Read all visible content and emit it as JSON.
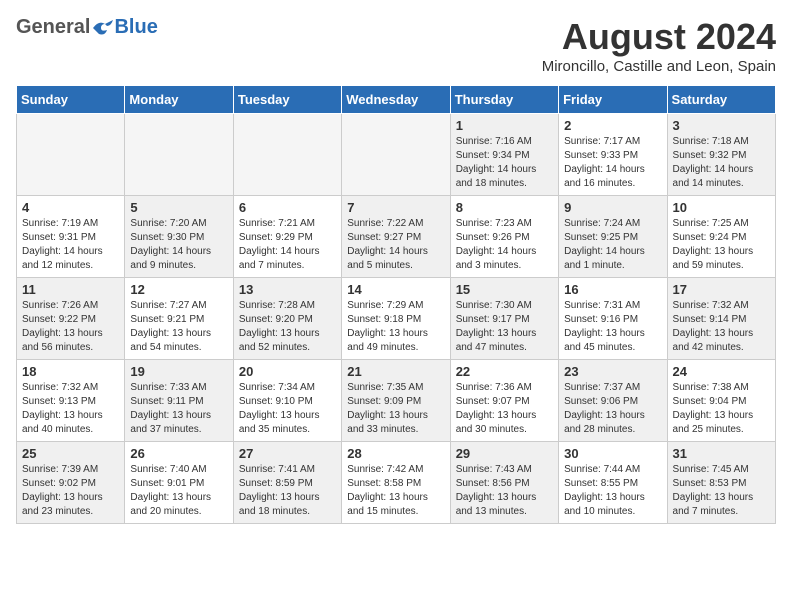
{
  "header": {
    "logo_general": "General",
    "logo_blue": "Blue",
    "title": "August 2024",
    "subtitle": "Mironcillo, Castille and Leon, Spain"
  },
  "days_of_week": [
    "Sunday",
    "Monday",
    "Tuesday",
    "Wednesday",
    "Thursday",
    "Friday",
    "Saturday"
  ],
  "weeks": [
    [
      {
        "day": "",
        "detail": "",
        "empty": true
      },
      {
        "day": "",
        "detail": "",
        "empty": true
      },
      {
        "day": "",
        "detail": "",
        "empty": true
      },
      {
        "day": "",
        "detail": "",
        "empty": true
      },
      {
        "day": "1",
        "detail": "Sunrise: 7:16 AM\nSunset: 9:34 PM\nDaylight: 14 hours\nand 18 minutes."
      },
      {
        "day": "2",
        "detail": "Sunrise: 7:17 AM\nSunset: 9:33 PM\nDaylight: 14 hours\nand 16 minutes."
      },
      {
        "day": "3",
        "detail": "Sunrise: 7:18 AM\nSunset: 9:32 PM\nDaylight: 14 hours\nand 14 minutes."
      }
    ],
    [
      {
        "day": "4",
        "detail": "Sunrise: 7:19 AM\nSunset: 9:31 PM\nDaylight: 14 hours\nand 12 minutes."
      },
      {
        "day": "5",
        "detail": "Sunrise: 7:20 AM\nSunset: 9:30 PM\nDaylight: 14 hours\nand 9 minutes."
      },
      {
        "day": "6",
        "detail": "Sunrise: 7:21 AM\nSunset: 9:29 PM\nDaylight: 14 hours\nand 7 minutes."
      },
      {
        "day": "7",
        "detail": "Sunrise: 7:22 AM\nSunset: 9:27 PM\nDaylight: 14 hours\nand 5 minutes."
      },
      {
        "day": "8",
        "detail": "Sunrise: 7:23 AM\nSunset: 9:26 PM\nDaylight: 14 hours\nand 3 minutes."
      },
      {
        "day": "9",
        "detail": "Sunrise: 7:24 AM\nSunset: 9:25 PM\nDaylight: 14 hours\nand 1 minute."
      },
      {
        "day": "10",
        "detail": "Sunrise: 7:25 AM\nSunset: 9:24 PM\nDaylight: 13 hours\nand 59 minutes."
      }
    ],
    [
      {
        "day": "11",
        "detail": "Sunrise: 7:26 AM\nSunset: 9:22 PM\nDaylight: 13 hours\nand 56 minutes."
      },
      {
        "day": "12",
        "detail": "Sunrise: 7:27 AM\nSunset: 9:21 PM\nDaylight: 13 hours\nand 54 minutes."
      },
      {
        "day": "13",
        "detail": "Sunrise: 7:28 AM\nSunset: 9:20 PM\nDaylight: 13 hours\nand 52 minutes."
      },
      {
        "day": "14",
        "detail": "Sunrise: 7:29 AM\nSunset: 9:18 PM\nDaylight: 13 hours\nand 49 minutes."
      },
      {
        "day": "15",
        "detail": "Sunrise: 7:30 AM\nSunset: 9:17 PM\nDaylight: 13 hours\nand 47 minutes."
      },
      {
        "day": "16",
        "detail": "Sunrise: 7:31 AM\nSunset: 9:16 PM\nDaylight: 13 hours\nand 45 minutes."
      },
      {
        "day": "17",
        "detail": "Sunrise: 7:32 AM\nSunset: 9:14 PM\nDaylight: 13 hours\nand 42 minutes."
      }
    ],
    [
      {
        "day": "18",
        "detail": "Sunrise: 7:32 AM\nSunset: 9:13 PM\nDaylight: 13 hours\nand 40 minutes."
      },
      {
        "day": "19",
        "detail": "Sunrise: 7:33 AM\nSunset: 9:11 PM\nDaylight: 13 hours\nand 37 minutes."
      },
      {
        "day": "20",
        "detail": "Sunrise: 7:34 AM\nSunset: 9:10 PM\nDaylight: 13 hours\nand 35 minutes."
      },
      {
        "day": "21",
        "detail": "Sunrise: 7:35 AM\nSunset: 9:09 PM\nDaylight: 13 hours\nand 33 minutes."
      },
      {
        "day": "22",
        "detail": "Sunrise: 7:36 AM\nSunset: 9:07 PM\nDaylight: 13 hours\nand 30 minutes."
      },
      {
        "day": "23",
        "detail": "Sunrise: 7:37 AM\nSunset: 9:06 PM\nDaylight: 13 hours\nand 28 minutes."
      },
      {
        "day": "24",
        "detail": "Sunrise: 7:38 AM\nSunset: 9:04 PM\nDaylight: 13 hours\nand 25 minutes."
      }
    ],
    [
      {
        "day": "25",
        "detail": "Sunrise: 7:39 AM\nSunset: 9:02 PM\nDaylight: 13 hours\nand 23 minutes."
      },
      {
        "day": "26",
        "detail": "Sunrise: 7:40 AM\nSunset: 9:01 PM\nDaylight: 13 hours\nand 20 minutes."
      },
      {
        "day": "27",
        "detail": "Sunrise: 7:41 AM\nSunset: 8:59 PM\nDaylight: 13 hours\nand 18 minutes."
      },
      {
        "day": "28",
        "detail": "Sunrise: 7:42 AM\nSunset: 8:58 PM\nDaylight: 13 hours\nand 15 minutes."
      },
      {
        "day": "29",
        "detail": "Sunrise: 7:43 AM\nSunset: 8:56 PM\nDaylight: 13 hours\nand 13 minutes."
      },
      {
        "day": "30",
        "detail": "Sunrise: 7:44 AM\nSunset: 8:55 PM\nDaylight: 13 hours\nand 10 minutes."
      },
      {
        "day": "31",
        "detail": "Sunrise: 7:45 AM\nSunset: 8:53 PM\nDaylight: 13 hours\nand 7 minutes."
      }
    ]
  ]
}
